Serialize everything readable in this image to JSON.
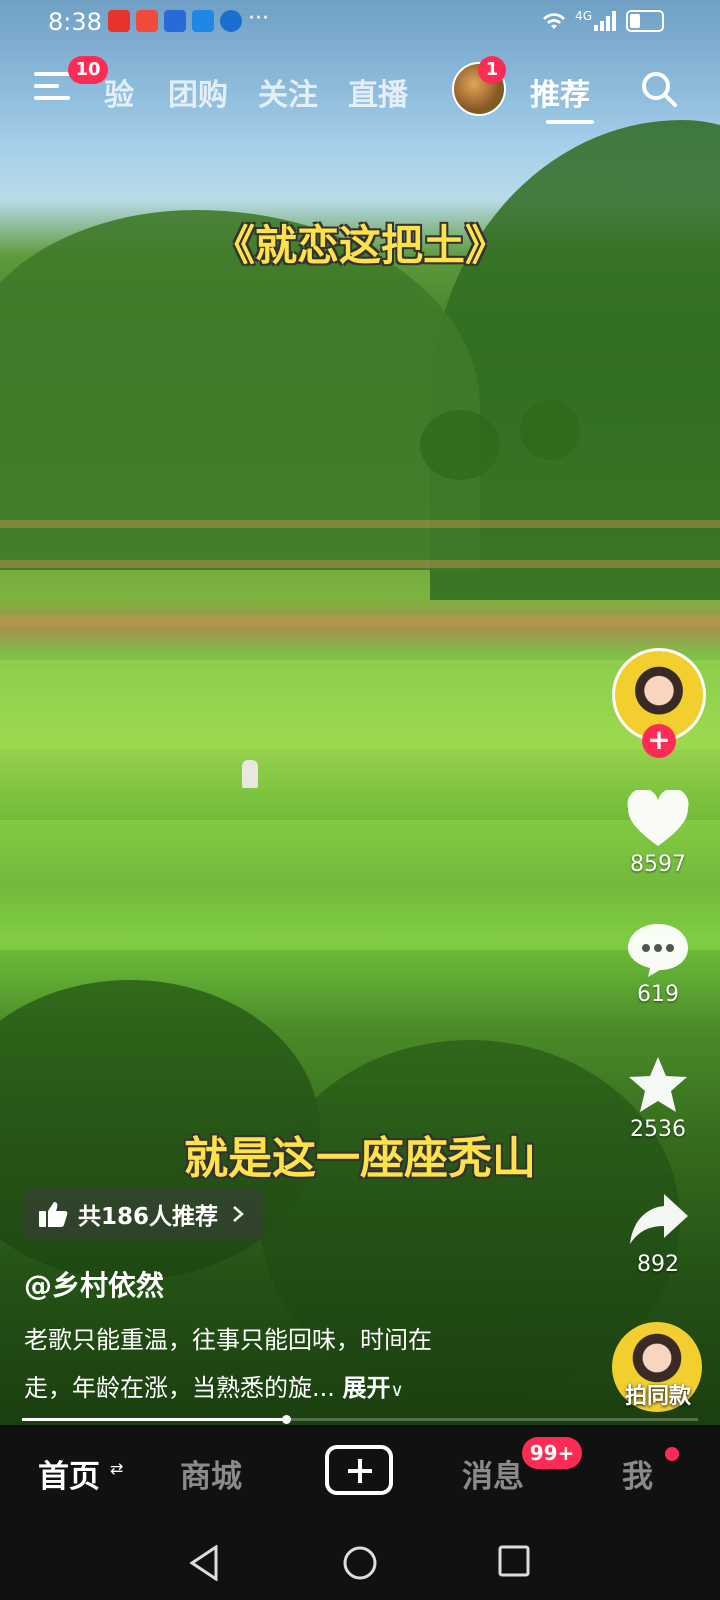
{
  "status_bar": {
    "time": "8:38",
    "more": "···",
    "network": "4G",
    "app_icon_colors": [
      "#e8322d",
      "#f04a3a",
      "#2a6ad8",
      "#1e88e5",
      "#1b6fd1"
    ]
  },
  "top_nav": {
    "menu_badge": "10",
    "tabs": [
      {
        "label": "验"
      },
      {
        "label": "团购"
      },
      {
        "label": "关注"
      },
      {
        "label": "直播"
      },
      {
        "label": "推荐"
      }
    ],
    "live_badge": "1",
    "active_tab": "推荐"
  },
  "video": {
    "title_overlay": "《就恋这把土》",
    "subtitle": "就是这一座座秃山"
  },
  "side_actions": {
    "follow_symbol": "+",
    "likes": "8597",
    "comments": "619",
    "favorites": "2536",
    "shares": "892",
    "same_style_label": "拍同款"
  },
  "info": {
    "recommend": "共186人推荐",
    "author": "@乡村依然",
    "desc_line1": "老歌只能重温，往事只能回味，时间在",
    "desc_line2": "走，年龄在涨，当熟悉的旋... ",
    "expand": "展开",
    "progress_fraction": 0.39
  },
  "bottom_nav": {
    "home": "首页",
    "mall": "商城",
    "messages": "消息",
    "messages_badge": "99+",
    "me": "我"
  },
  "colors": {
    "accent": "#fe2c55",
    "overlay_text": "#ffe24a",
    "bar_bg": "#111111"
  }
}
